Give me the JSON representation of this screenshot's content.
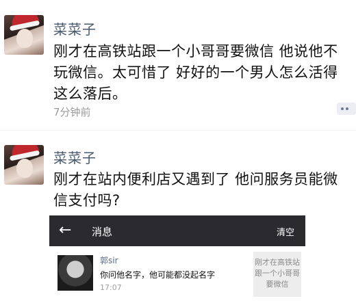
{
  "posts": [
    {
      "nickname": "菜菜子",
      "text": "刚才在高铁站跟一个小哥哥要微信 他说他不玩微信。太可惜了 好好的一个男人怎么活得这么落后。",
      "time": "7分钟前"
    },
    {
      "nickname": "菜菜子",
      "text": "刚才在站内便利店又遇到了 他问服务员能微信支付吗?"
    }
  ],
  "embedded_screenshot": {
    "header_back": "←",
    "header_title": "消息",
    "header_clear": "清空",
    "message": {
      "name": "郭sir",
      "text": "你问他名字，他可能都没起名字",
      "time": "17:07",
      "quoted": "刚才在高铁站跟一个小哥哥要微信"
    }
  }
}
